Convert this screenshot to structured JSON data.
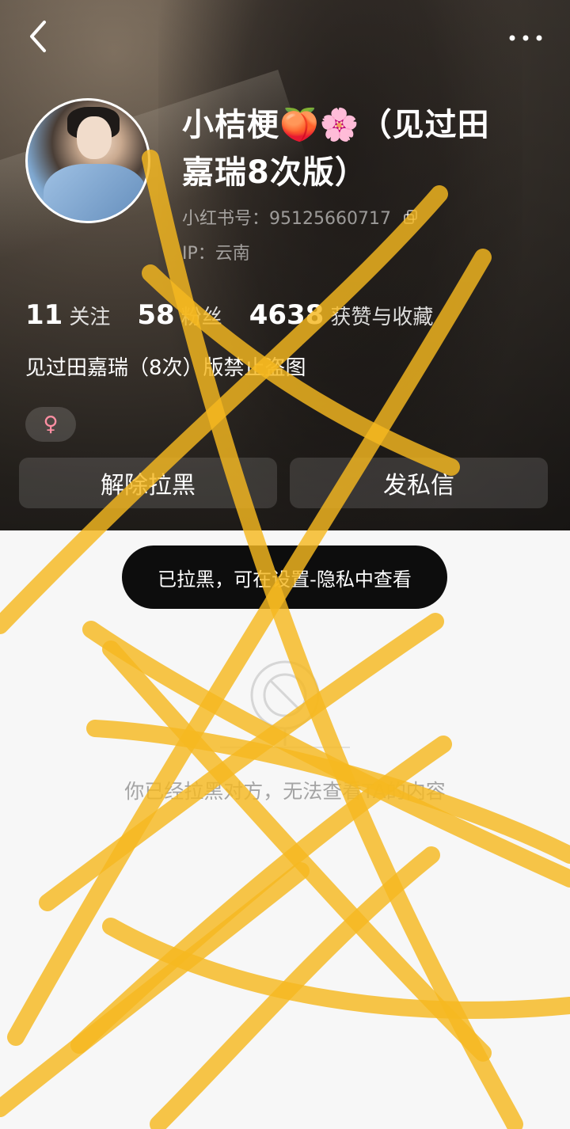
{
  "header": {
    "name": "小桔梗🍑🌸（见过田嘉瑞8次版）",
    "account_label": "小红书号：",
    "account_id": "95125660717",
    "ip_label": "IP：",
    "ip_value": "云南",
    "stats": [
      {
        "num": "11",
        "label": "关注"
      },
      {
        "num": "58",
        "label": "粉丝"
      },
      {
        "num": "4638",
        "label": "获赞与收藏"
      }
    ],
    "bio": "见过田嘉瑞（8次）版禁止盗图",
    "gender_symbol": "♀",
    "buttons": {
      "unblock": "解除拉黑",
      "message": "发私信"
    }
  },
  "toast": "已拉黑，可在设置-隐私中查看",
  "empty": {
    "text": "你已经拉黑对方，无法查看TA的内容"
  },
  "icons": [
    "back-icon",
    "more-icon",
    "copy-icon",
    "female-icon",
    "blocked-icon"
  ],
  "colors": {
    "scribble": "#f5b820",
    "toast_bg": "#0d0d0d",
    "gender": "#ff8fa3",
    "empty_text": "#a4a4a4"
  }
}
